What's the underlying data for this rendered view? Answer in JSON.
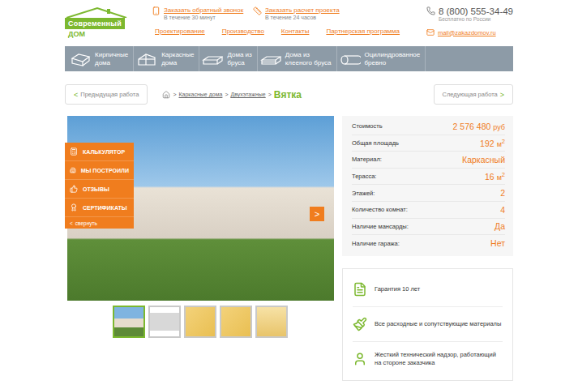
{
  "header": {
    "logo": {
      "line1": "Современный",
      "line2": "ДОМ"
    },
    "contacts": [
      {
        "title": "Заказать обратный звонок",
        "note": "В течение 30 минут",
        "kind": "call"
      },
      {
        "title": "Заказать расчет проекта",
        "note": "В течение 24 часов",
        "kind": "estimate"
      }
    ],
    "links": [
      "Проектирование",
      "Производство",
      "Контакты",
      "Партнерская программа"
    ],
    "phone": {
      "number": "8 (800) 555-34-49",
      "note": "Бесплатно по России"
    },
    "email": "mail@zakazdomov.ru"
  },
  "nav": [
    {
      "lines": [
        "Кирпичные",
        "дома"
      ],
      "kind": "brick"
    },
    {
      "lines": [
        "Каркасные",
        "дома"
      ],
      "kind": "frame"
    },
    {
      "lines": [
        "Дома из",
        "бруса"
      ],
      "kind": "beam"
    },
    {
      "lines": [
        "Дома из",
        "клееного бруса"
      ],
      "kind": "glued"
    },
    {
      "lines": [
        "Оцилиндрованное",
        "бревно"
      ],
      "kind": "log"
    }
  ],
  "pager": {
    "prev": {
      "arrow": "<",
      "label": "Предыдущая работа"
    },
    "next": {
      "label": "Следующая работа",
      "arrow": ">"
    }
  },
  "breadcrumbs": {
    "separator": ">",
    "items": [
      "Каркасные дома",
      "Двухэтажные"
    ],
    "current": "Вятка"
  },
  "side_menu": {
    "items": [
      {
        "label": "КАЛЬКУЛЯТОР",
        "kind": "calculator"
      },
      {
        "label": "МЫ ПОСТРОИЛИ",
        "kind": "built"
      },
      {
        "label": "ОТЗЫВЫ",
        "kind": "reviews"
      },
      {
        "label": "СЕРТИФИКАТЫ",
        "kind": "certificates"
      }
    ],
    "collapse": {
      "arrow": "<",
      "label": "свернуть"
    }
  },
  "gallery": {
    "next_arrow": ">",
    "thumbnails": [
      {
        "kind": "photo",
        "selected": true
      },
      {
        "kind": "facade",
        "selected": false
      },
      {
        "kind": "plan",
        "selected": false
      },
      {
        "kind": "plan",
        "selected": false
      },
      {
        "kind": "section",
        "selected": false
      }
    ]
  },
  "specs": [
    {
      "label": "Стоимость",
      "value": "2 576 480",
      "unit": "руб",
      "unit_sup": ""
    },
    {
      "label": "Общая площадь",
      "value": "192",
      "unit": "м",
      "unit_sup": "2"
    },
    {
      "label": "Материал:",
      "value": "Каркасный",
      "unit": "",
      "unit_sup": ""
    },
    {
      "label": "Терасса:",
      "value": "16",
      "unit": "м",
      "unit_sup": "2"
    },
    {
      "label": "Этажей:",
      "value": "2",
      "unit": "",
      "unit_sup": ""
    },
    {
      "label": "Количество комнат:",
      "value": "4",
      "unit": "",
      "unit_sup": ""
    },
    {
      "label": "Наличие мансарды:",
      "value": "Да",
      "unit": "",
      "unit_sup": ""
    },
    {
      "label": "Наличие гаража:",
      "value": "Нет",
      "unit": "",
      "unit_sup": ""
    }
  ],
  "features": [
    {
      "label": "Гарантия 10 лет",
      "kind": "warranty"
    },
    {
      "label": "Все расходные и сопутствующие материалы",
      "kind": "materials"
    },
    {
      "label": "Жесткий технический надзор, работающий на стороне заказчика",
      "kind": "supervision"
    }
  ]
}
